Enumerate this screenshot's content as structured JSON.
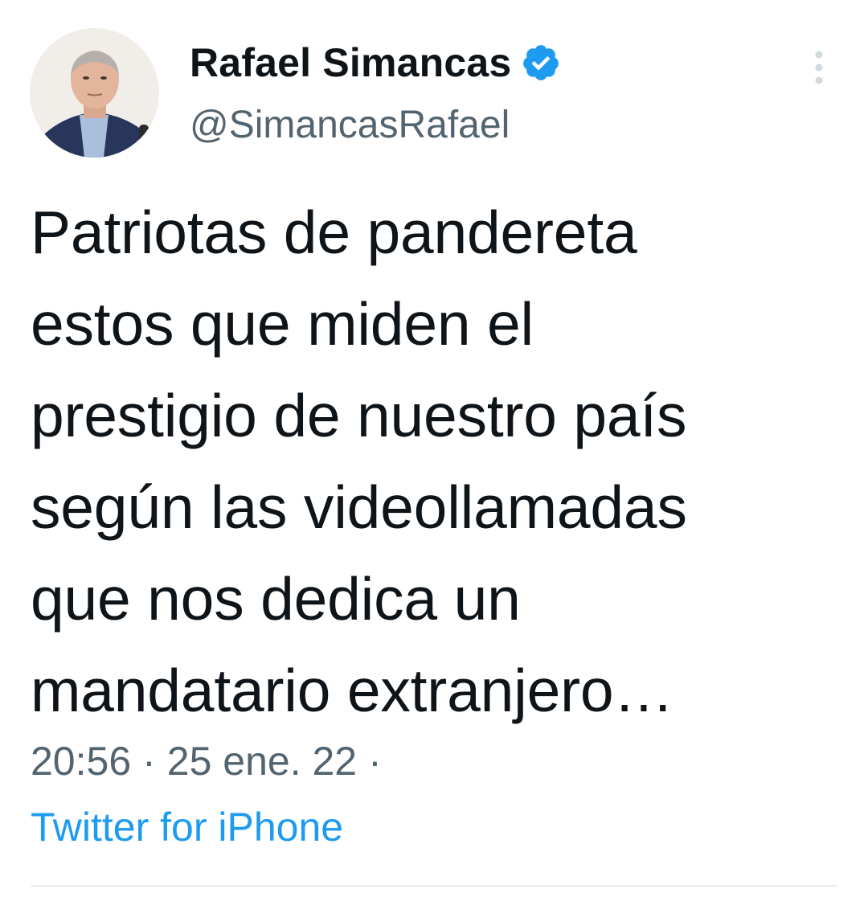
{
  "author": {
    "display_name": "Rafael Simancas",
    "handle": "@SimancasRafael",
    "verified": true,
    "verified_color": "#1d9bf0"
  },
  "tweet": {
    "text": "Patriotas de pandereta\nestos que miden el\nprestigio de nuestro país\nsegún las videollamadas\nque nos dedica un\nmandatario extranjero…"
  },
  "meta": {
    "time": "20:56",
    "separator": "·",
    "date": "25 ene. 22",
    "trailing_separator": "·",
    "source": "Twitter for iPhone"
  },
  "icons": {
    "more": "more-vertical-icon",
    "verified": "verified-badge-icon"
  },
  "colors": {
    "text": "#0f1419",
    "secondary": "#536471",
    "link": "#1d9bf0"
  }
}
